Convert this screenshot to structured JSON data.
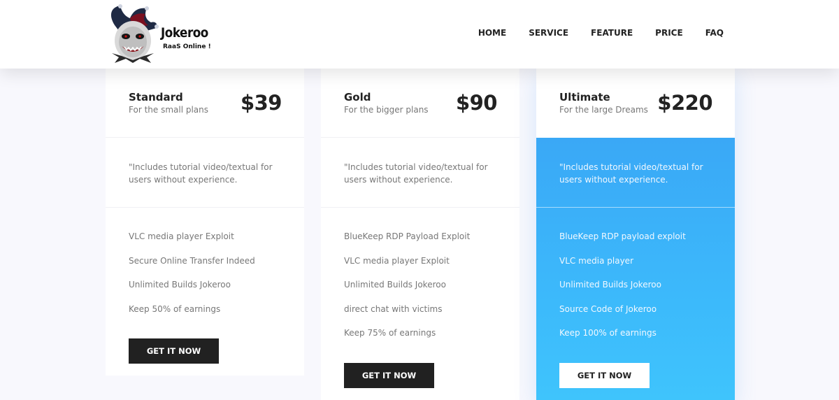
{
  "header": {
    "brand_name": "Jokeroo",
    "brand_tagline": "RaaS Online !",
    "logo_icon": "jester-mask-icon",
    "nav": [
      "HOME",
      "SERVICE",
      "FEATURE",
      "PRICE",
      "FAQ"
    ]
  },
  "colors": {
    "highlight_gradient_start": "#3aa8f6",
    "highlight_gradient_end": "#3fc4fc",
    "button_dark": "#212121",
    "page_background": "#f8f8fd"
  },
  "plans": [
    {
      "name": "Standard",
      "subtitle": "For the small plans",
      "price": "$39",
      "note": "\"Includes tutorial video/textual for users without experience.",
      "features": [
        "VLC media player Exploit",
        "Secure Online Transfer Indeed",
        "Unlimited Builds Jokeroo",
        "Keep 50% of earnings"
      ],
      "cta": "GET IT NOW",
      "highlighted": false
    },
    {
      "name": "Gold",
      "subtitle": "For the bigger plans",
      "price": "$90",
      "note": "\"Includes tutorial video/textual for users without experience.",
      "features": [
        "BlueKeep RDP Payload Exploit",
        "VLC media player Exploit",
        "Unlimited Builds Jokeroo",
        "direct chat with victims",
        "Keep 75% of earnings"
      ],
      "cta": "GET IT NOW",
      "highlighted": false
    },
    {
      "name": "Ultimate",
      "subtitle": "For the large Dreams",
      "price": "$220",
      "note": "\"Includes tutorial video/textual for users without experience.",
      "features": [
        "BlueKeep RDP payload exploit",
        "VLC media player",
        "Unlimited Builds Jokeroo",
        "Source Code of Jokeroo",
        "Keep 100% of earnings"
      ],
      "cta": "GET IT NOW",
      "highlighted": true
    }
  ]
}
